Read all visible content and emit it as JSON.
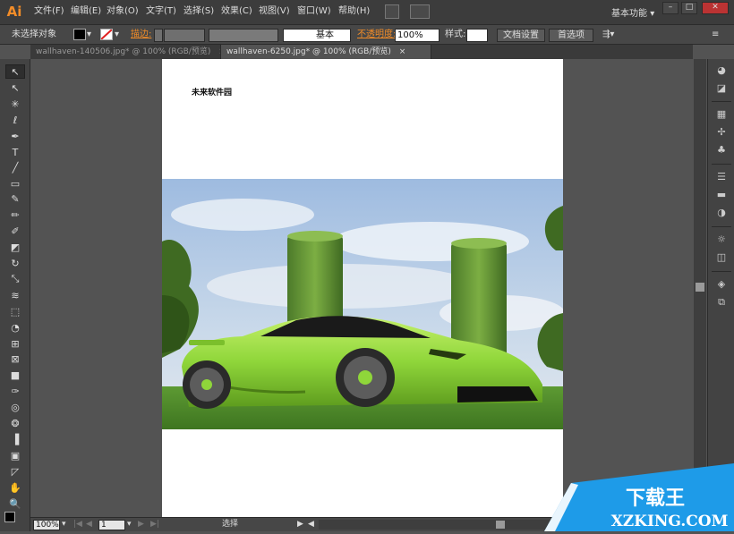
{
  "app": {
    "logo": "Ai"
  },
  "menu": [
    "文件(F)",
    "编辑(E)",
    "对象(O)",
    "文字(T)",
    "选择(S)",
    "效果(C)",
    "视图(V)",
    "窗口(W)",
    "帮助(H)"
  ],
  "workspace": {
    "label": "基本功能",
    "arrow": "▾"
  },
  "window_buttons": {
    "minimize": "–",
    "maximize": "□",
    "close": "✕"
  },
  "control": {
    "selection_label": "未选择对象",
    "stroke_label": "描边:",
    "stroke_style": "基本",
    "opacity_label": "不透明度:",
    "opacity_value": "100%",
    "style_label": "样式:",
    "doc_setup_button": "文档设置",
    "preferences_button": "首选项",
    "arrow": "▾"
  },
  "tabs": [
    {
      "title": "wallhaven-140506.jpg* @ 100% (RGB/预览)",
      "close": "×"
    },
    {
      "title": "wallhaven-6250.jpg* @ 100% (RGB/预览)",
      "close": "×"
    }
  ],
  "document": {
    "text": "未来软件园"
  },
  "status": {
    "zoom": "100%",
    "page": "1",
    "tool": "选择",
    "arrow": "▾",
    "first": "|◀",
    "prev": "◀",
    "next": "▶",
    "last": "▶|",
    "play": "▶",
    "scroll_left": "◀"
  },
  "watermark": {
    "title": "下载王",
    "domain": "XZKING.COM"
  },
  "tools": [
    "selection-tool",
    "direct-selection-tool",
    "magic-wand-tool",
    "lasso-tool",
    "pen-tool",
    "type-tool",
    "line-tool",
    "rectangle-tool",
    "paintbrush-tool",
    "pencil-tool",
    "blob-brush-tool",
    "eraser-tool",
    "rotate-tool",
    "scale-tool",
    "width-tool",
    "free-transform-tool",
    "shape-builder-tool",
    "perspective-grid-tool",
    "mesh-tool",
    "gradient-tool",
    "eyedropper-tool",
    "blend-tool",
    "symbol-sprayer-tool",
    "column-graph-tool",
    "artboard-tool",
    "slice-tool",
    "hand-tool",
    "zoom-tool"
  ],
  "tool_glyphs": [
    "↖",
    "↖",
    "✳",
    "ℓ",
    "✒",
    "T",
    "╱",
    "▭",
    "✎",
    "✏",
    "✐",
    "◩",
    "↻",
    "⤡",
    "≋",
    "⬚",
    "◔",
    "⊞",
    "⊠",
    "■",
    "✑",
    "◎",
    "❂",
    "▐",
    "▣",
    "◸",
    "✋",
    "🔍"
  ],
  "panels": [
    {
      "name": "color-panel-icon",
      "glyph": "◕"
    },
    {
      "name": "color-guide-icon",
      "glyph": "◪"
    },
    {
      "name": "swatches-icon",
      "glyph": "▦"
    },
    {
      "name": "brushes-icon",
      "glyph": "✢"
    },
    {
      "name": "symbols-icon",
      "glyph": "♣"
    },
    {
      "name": "stroke-icon",
      "glyph": "☰"
    },
    {
      "name": "gradient-icon",
      "glyph": "▬"
    },
    {
      "name": "transparency-icon",
      "glyph": "◑"
    },
    {
      "name": "appearance-icon",
      "glyph": "☼"
    },
    {
      "name": "graphic-styles-icon",
      "glyph": "◫"
    },
    {
      "name": "layers-icon",
      "glyph": "◈"
    },
    {
      "name": "artboards-icon",
      "glyph": "⧉"
    }
  ],
  "colors": {
    "accent": "#f28c28",
    "car_green": "#8fd63a",
    "sky": "#b7cde3",
    "grass": "#4f8a2a",
    "watermark_blue": "#1e9be8"
  }
}
